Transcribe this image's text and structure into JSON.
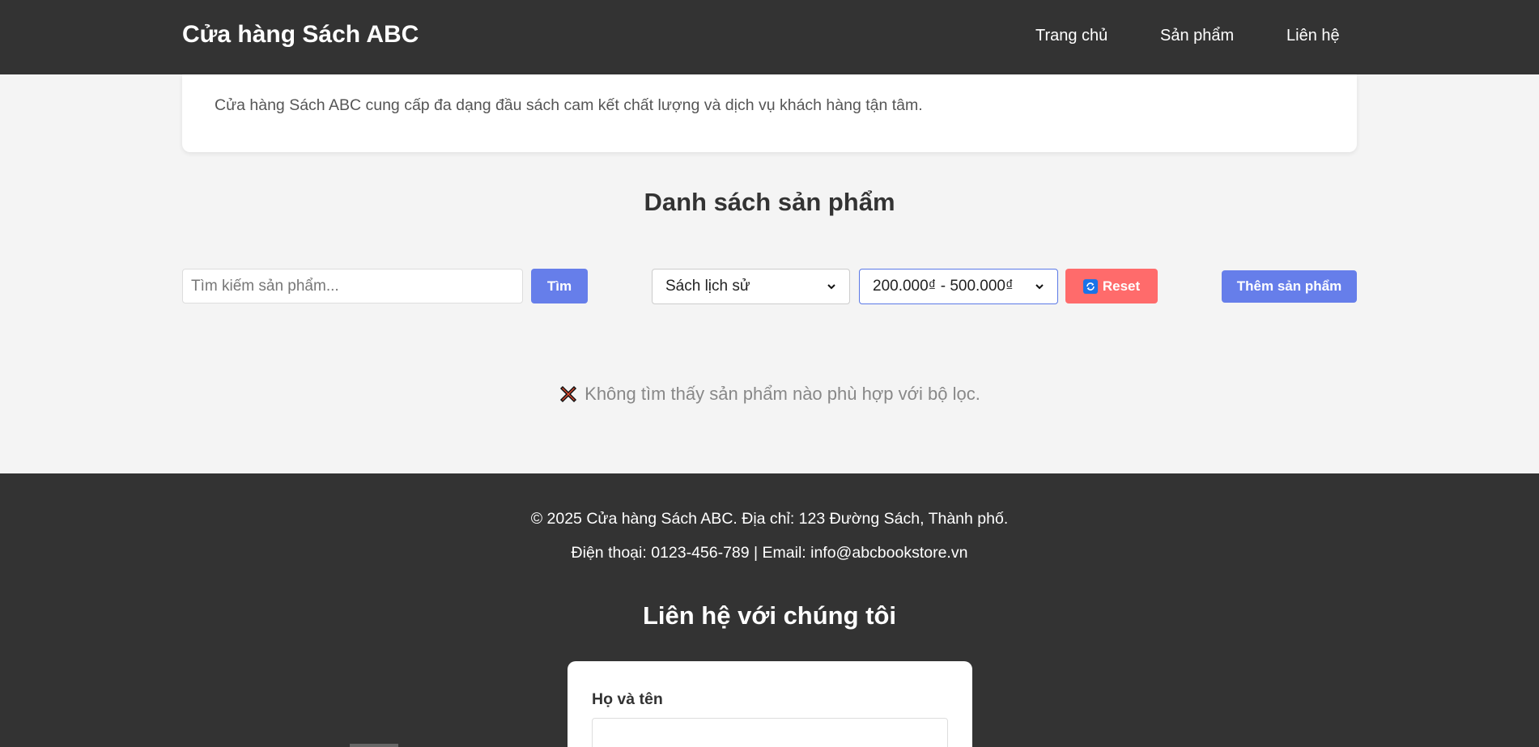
{
  "header": {
    "brand": "Cửa hàng Sách ABC",
    "nav": [
      "Trang chủ",
      "Sản phẩm",
      "Liên hệ"
    ]
  },
  "intro": {
    "text": "Cửa hàng Sách ABC cung cấp đa dạng đầu sách cam kết chất lượng và dịch vụ khách hàng tận tâm."
  },
  "products": {
    "title": "Danh sách sản phẩm",
    "search": {
      "placeholder": "Tìm kiếm sản phẩm...",
      "value": ""
    },
    "search_button": "Tìm",
    "category_filter": {
      "selected": "Sách lịch sử"
    },
    "price_filter": {
      "selected": "200.000₫ - 500.000₫"
    },
    "reset_button": "Reset",
    "add_button": "Thêm sản phẩm",
    "empty_message": "Không tìm thấy sản phẩm nào phù hợp với bộ lọc."
  },
  "footer": {
    "copyright": "© 2025 Cửa hàng Sách ABC. Địa chỉ: 123 Đường Sách, Thành phố.",
    "contact_line": "Điện thoại: 0123-456-789 | Email: info@abcbookstore.vn",
    "contact_title": "Liên hệ với chúng tôi",
    "form": {
      "name_label": "Họ và tên",
      "name_value": ""
    }
  },
  "colors": {
    "header_bg": "#333333",
    "accent": "#667eea",
    "reset": "#ff6b6b",
    "page_bg": "#f4f4f4"
  },
  "icons": {
    "reset": "refresh-icon",
    "empty": "cross-mark-icon",
    "select": "chevron-down-icon"
  }
}
